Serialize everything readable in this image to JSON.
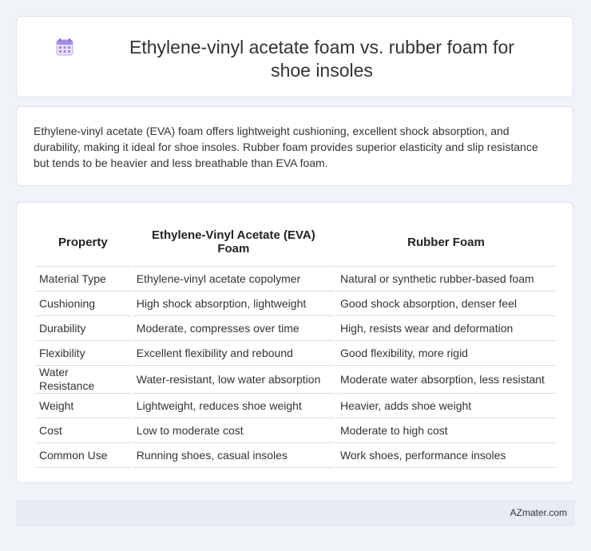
{
  "header": {
    "icon": "calendar-icon",
    "title": "Ethylene-vinyl acetate foam vs. rubber foam for shoe insoles"
  },
  "summary": "Ethylene-vinyl acetate (EVA) foam offers lightweight cushioning, excellent shock absorption, and durability, making it ideal for shoe insoles. Rubber foam provides superior elasticity and slip resistance but tends to be heavier and less breathable than EVA foam.",
  "table": {
    "headers": [
      "Property",
      "Ethylene-Vinyl Acetate (EVA) Foam",
      "Rubber Foam"
    ],
    "rows": [
      [
        "Material Type",
        "Ethylene-vinyl acetate copolymer",
        "Natural or synthetic rubber-based foam"
      ],
      [
        "Cushioning",
        "High shock absorption, lightweight",
        "Good shock absorption, denser feel"
      ],
      [
        "Durability",
        "Moderate, compresses over time",
        "High, resists wear and deformation"
      ],
      [
        "Flexibility",
        "Excellent flexibility and rebound",
        "Good flexibility, more rigid"
      ],
      [
        "Water Resistance",
        "Water-resistant, low water absorption",
        "Moderate water absorption, less resistant"
      ],
      [
        "Weight",
        "Lightweight, reduces shoe weight",
        "Heavier, adds shoe weight"
      ],
      [
        "Cost",
        "Low to moderate cost",
        "Moderate to high cost"
      ],
      [
        "Common Use",
        "Running shoes, casual insoles",
        "Work shoes, performance insoles"
      ]
    ]
  },
  "footer": {
    "brand": "AZmater.com"
  }
}
